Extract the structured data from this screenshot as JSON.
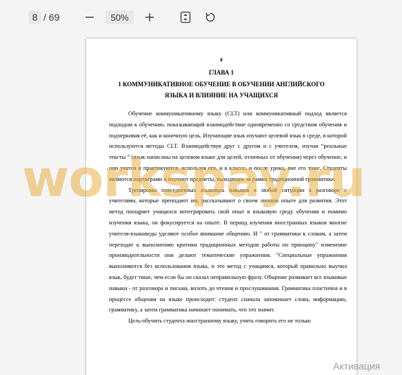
{
  "toolbar": {
    "page_current": "8",
    "page_total": "/ 69",
    "zoom": "50%"
  },
  "icons": {
    "zoom_out": "minus-icon",
    "zoom_in": "plus-icon",
    "fit": "fit-page-icon",
    "rotate": "rotate-icon"
  },
  "document": {
    "page_number": "8",
    "chapter": "ГЛАВА 1",
    "title_line1": "1 КОММУНИКАТИВНОЕ ОБУЧЕНИЕ В ОБУЧЕНИИ АНГЛИЙСКОГО",
    "title_line2": "ЯЗЫКА И ВЛИЯНИЕ НА УЧАЩИХСЯ",
    "paragraphs": [
      "Обучение коммуникативному языку (CLT) или коммуникативный подход является подходом к обучению, показывающий взаимодействие одновременно со средством обучения и подчеркивая её, как и конечную цель. Изучающие язык изучают целевой язык в среде, в которой используются методы CLT. Взаимодействуя друг с другом и с учителем, изучая “реальные тексты ” (язык написаны на целевом языке для целей, отличных от обучения) через обучение, и они учатся и практикуются, используя его, и в классе, и после урока, вне его тоже. Студенты являются партнерами и изучают предметы, выходящие за рамки традиционной грамматики.",
      "Тренировка повседневных языковых навыков в любой ситуации в разговоре с учителями, которые преподают им, рассказывают о своем личном опыте для развития. Этот метод поощряет учащихся интегрировать свой опыт в языковую среду обучения и помимо изучения языка, он фокусируется на опыте. В период изучения иностранных языков многие учителя-языковеды уделяют особое внимание общению. И \" от грамматики к словам, а затем переходят к выполнению критики традиционных методов работы по принципу\" изменение производительности они делают тематические упражнения. \"Специальные упражнения выполняются без использования языка, и это метод с учащимся, который правильно выучил язык, будет тише, чем если бы он сказал неправильную фразу. Общение развивает все языковые навыки - от разговора и письма, вплоть до чтения и прослушивания. Грамматика пластична и в процессе общения на языке происходит: студент сначала запоминает слова, информацию, грамматику, а затем грамматика начинает понимать, что это значит.",
      "Цель-обучить студента иностранному языку, учить говорить его не только"
    ]
  },
  "overlay": {
    "watermark": "workspay.ru",
    "activation": "Активация"
  }
}
